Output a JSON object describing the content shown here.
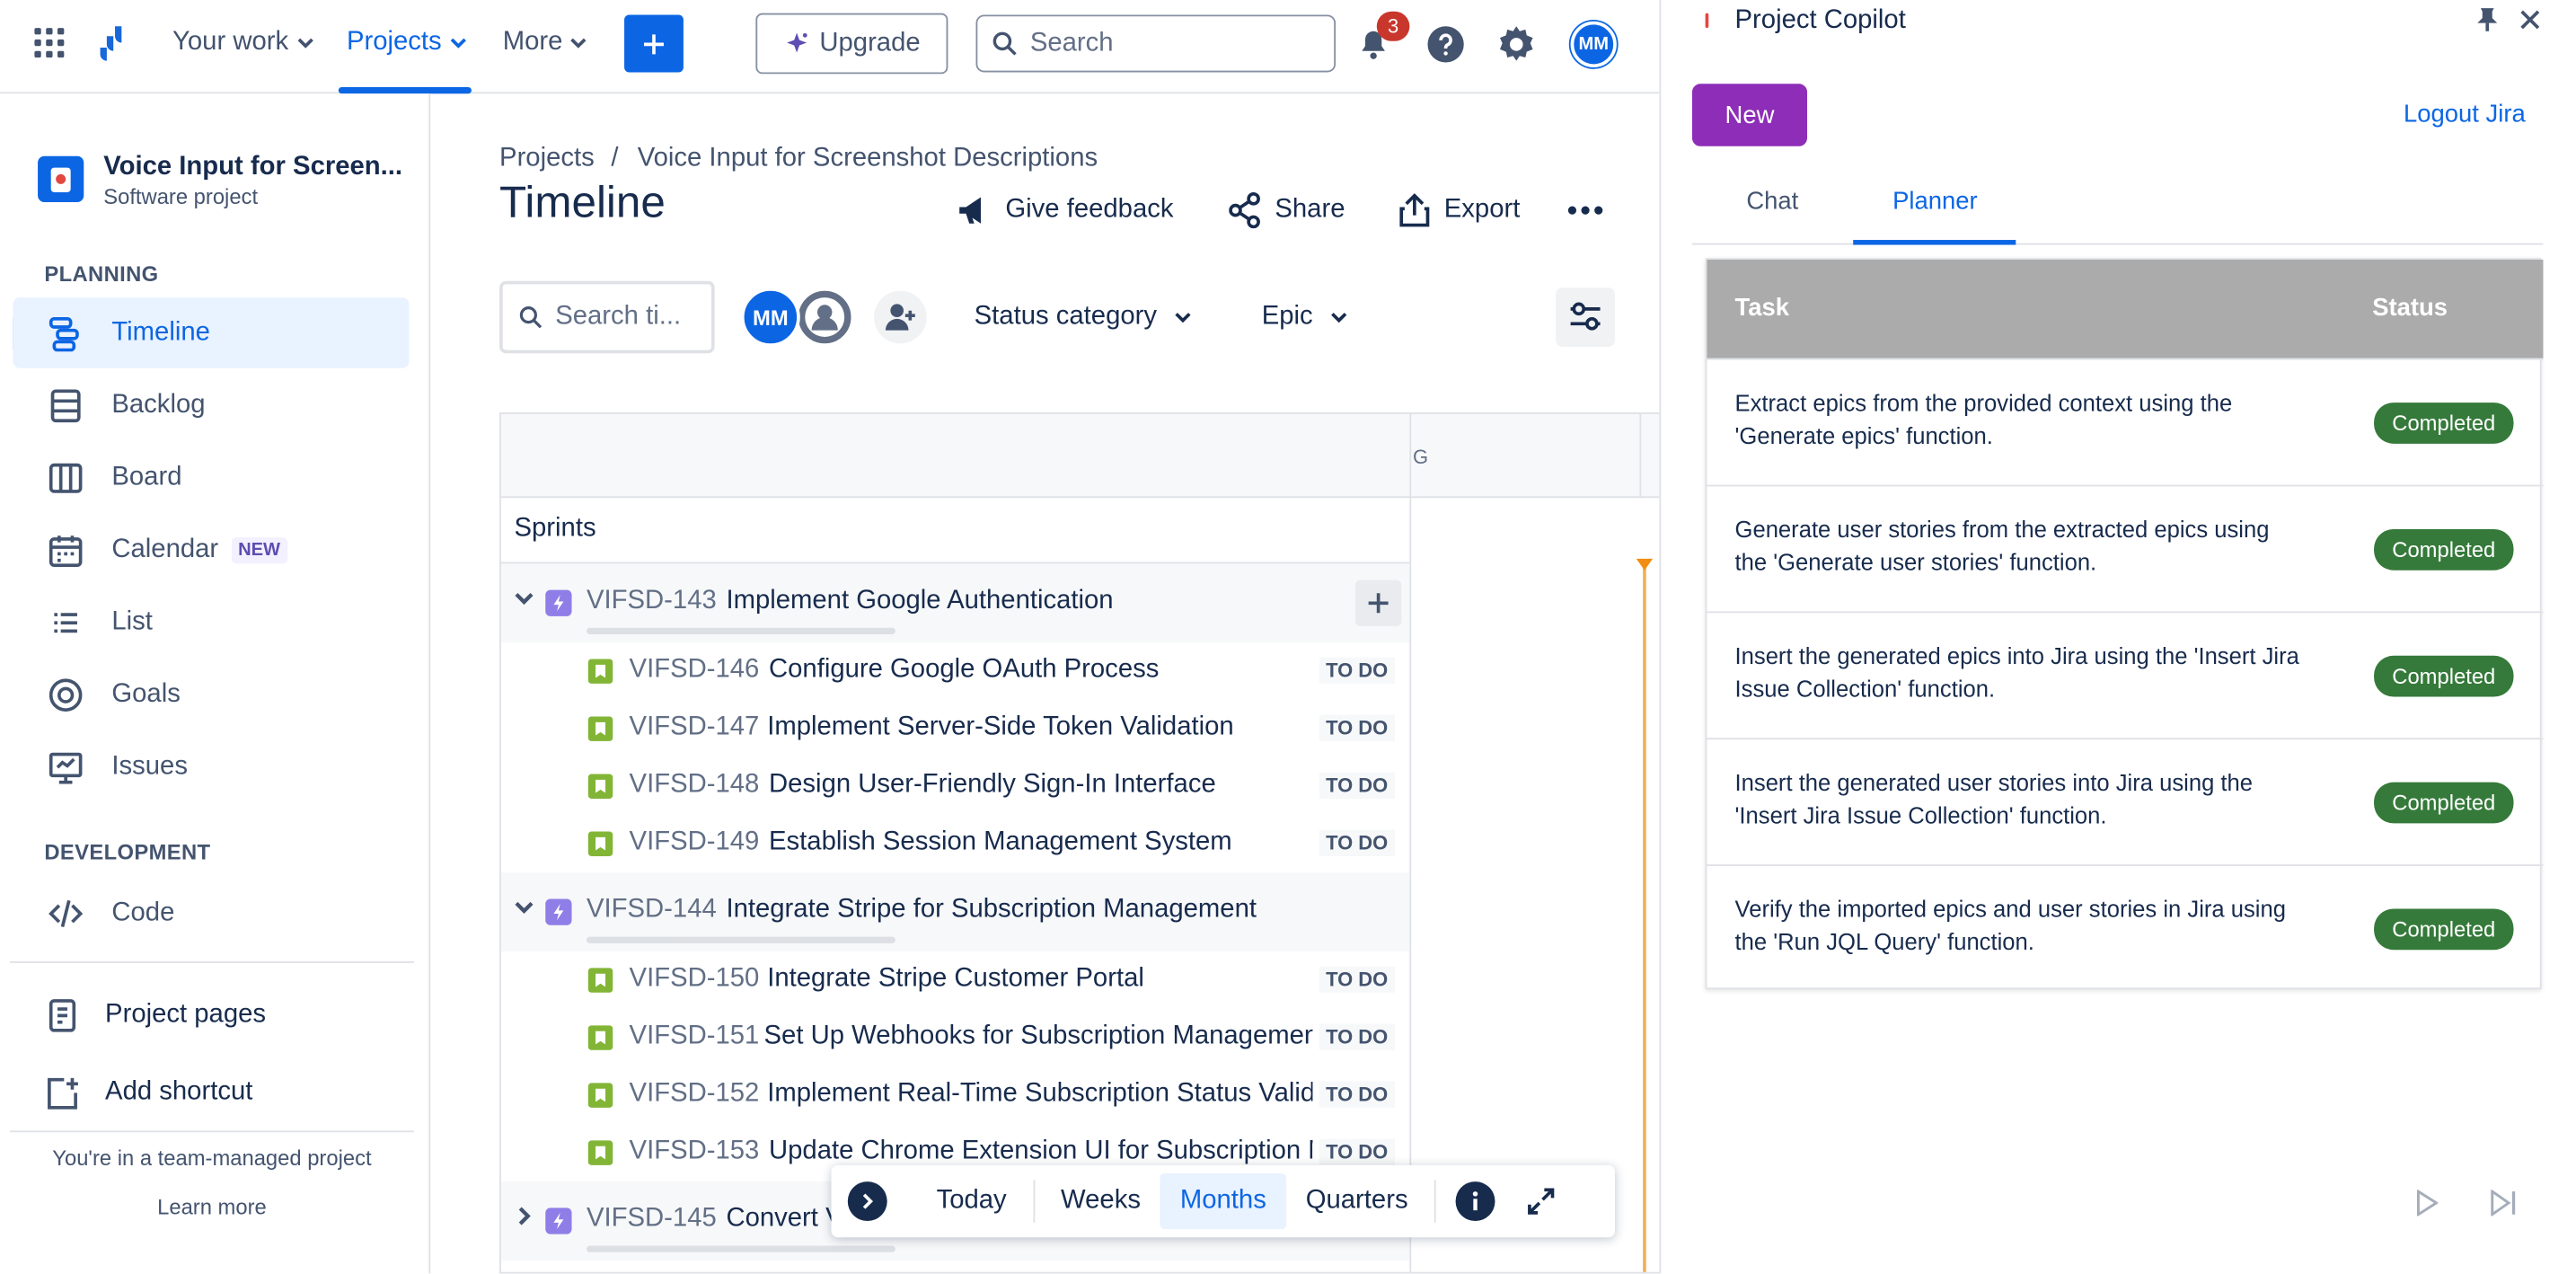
{
  "topnav": {
    "your_work": "Your work",
    "projects": "Projects",
    "more": "More",
    "upgrade": "Upgrade",
    "search_placeholder": "Search",
    "notifications_count": "3",
    "avatar_initials": "MM"
  },
  "sidebar": {
    "project_name": "Voice Input for Screen...",
    "project_type": "Software project",
    "planning_header": "PLANNING",
    "planning_items": [
      {
        "label": "Timeline",
        "icon": "timeline-icon",
        "active": true
      },
      {
        "label": "Backlog",
        "icon": "backlog-icon"
      },
      {
        "label": "Board",
        "icon": "board-icon"
      },
      {
        "label": "Calendar",
        "icon": "calendar-icon",
        "badge": "NEW"
      },
      {
        "label": "List",
        "icon": "list-icon"
      },
      {
        "label": "Goals",
        "icon": "goals-icon"
      },
      {
        "label": "Issues",
        "icon": "issues-icon"
      }
    ],
    "development_header": "DEVELOPMENT",
    "code_label": "Code",
    "project_pages": "Project pages",
    "add_shortcut": "Add shortcut",
    "footer_text": "You're in a team-managed project",
    "learn_more": "Learn more"
  },
  "main": {
    "breadcrumb_projects": "Projects",
    "breadcrumb_separator": "/",
    "breadcrumb_project": "Voice Input for Screenshot Descriptions",
    "title": "Timeline",
    "give_feedback": "Give feedback",
    "share": "Share",
    "export": "Export",
    "search_placeholder": "Search ti...",
    "avatar_initials": "MM",
    "status_filter": "Status category",
    "epic_filter": "Epic",
    "month_header_partial": "G",
    "sprints_label": "Sprints",
    "epics": [
      {
        "key": "VIFSD-143",
        "title": "Implement Google Authentication",
        "stories": [
          {
            "key": "VIFSD-146",
            "title": "Configure Google OAuth Process",
            "status": "TO DO"
          },
          {
            "key": "VIFSD-147",
            "title": "Implement Server-Side Token Validation",
            "status": "TO DO"
          },
          {
            "key": "VIFSD-148",
            "title": "Design User-Friendly Sign-In Interface",
            "status": "TO DO"
          },
          {
            "key": "VIFSD-149",
            "title": "Establish Session Management System",
            "status": "TO DO"
          }
        ]
      },
      {
        "key": "VIFSD-144",
        "title": "Integrate Stripe for Subscription Management",
        "stories": [
          {
            "key": "VIFSD-150",
            "title": "Integrate Stripe Customer Portal",
            "status": "TO DO"
          },
          {
            "key": "VIFSD-151",
            "title": "Set Up Webhooks for Subscription Managemen",
            "status": "TO DO"
          },
          {
            "key": "VIFSD-152",
            "title": "Implement Real-Time Subscription Status Valid",
            "status": "TO DO"
          },
          {
            "key": "VIFSD-153",
            "title": "Update Chrome Extension UI for Subscription M",
            "status": "TO DO"
          }
        ]
      },
      {
        "key": "VIFSD-145",
        "title": "Convert V",
        "stories": []
      }
    ],
    "zoom": {
      "today": "Today",
      "weeks": "Weeks",
      "months": "Months",
      "quarters": "Quarters",
      "selected": "Months"
    }
  },
  "panel": {
    "title": "Project Copilot",
    "new_button": "New",
    "logout": "Logout Jira",
    "tabs": [
      {
        "label": "Chat"
      },
      {
        "label": "Planner",
        "active": true
      }
    ],
    "table_headers": {
      "task": "Task",
      "status": "Status"
    },
    "tasks": [
      {
        "text": "Extract epics from the provided context using the 'Generate epics' function.",
        "status": "Completed"
      },
      {
        "text": "Generate user stories from the extracted epics using the 'Generate user stories' function.",
        "status": "Completed"
      },
      {
        "text": "Insert the generated epics into Jira using the 'Insert Jira Issue Collection' function.",
        "status": "Completed"
      },
      {
        "text": "Insert the generated user stories into Jira using the 'Insert Jira Issue Collection' function.",
        "status": "Completed"
      },
      {
        "text": "Verify the imported epics and user stories in Jira using the 'Run JQL Query' function.",
        "status": "Completed"
      }
    ]
  },
  "colors": {
    "accent": "#0c66e4",
    "epic_purple": "#8f7ee7",
    "story_green": "#82b536",
    "completed_green": "#357a3a",
    "new_button_purple": "#8e2db8",
    "today_orange": "#f18d13"
  }
}
